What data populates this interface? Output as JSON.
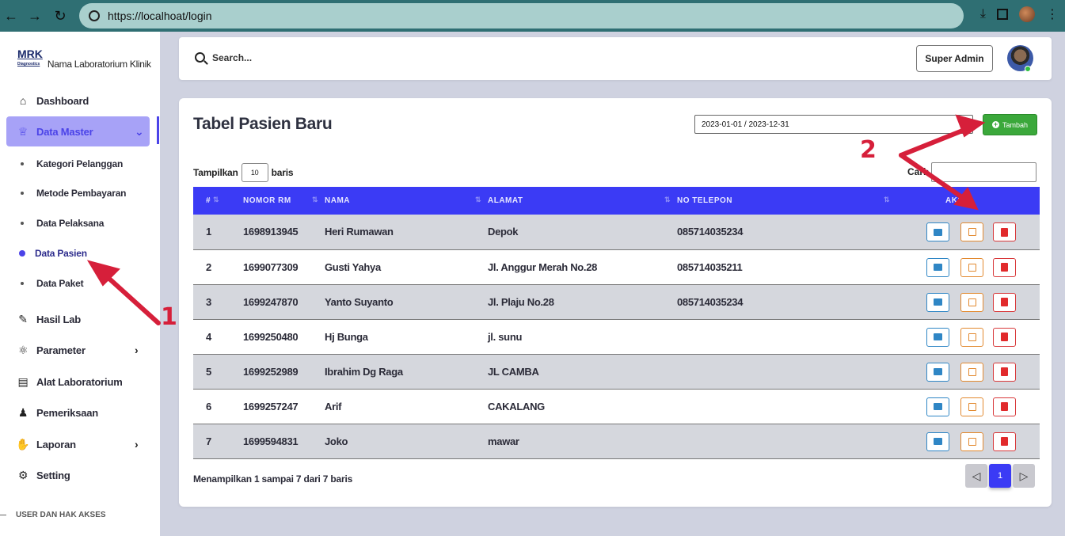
{
  "browser": {
    "url": "https://localhoat/login"
  },
  "brand": {
    "logo": "MRK",
    "logo_sub": "Diagnostics",
    "name": "Nama Laboratorium Klinik"
  },
  "sidebar": {
    "items": [
      {
        "label": "Dashboard",
        "icon": "home-icon"
      },
      {
        "label": "Data Master",
        "icon": "crown-icon"
      },
      {
        "label": "Hasil Lab",
        "icon": "pen-icon"
      },
      {
        "label": "Parameter",
        "icon": "atom-icon"
      },
      {
        "label": "Alat Laboratorium",
        "icon": "briefcase-icon"
      },
      {
        "label": "Pemeriksaan",
        "icon": "user-check-icon"
      },
      {
        "label": "Laporan",
        "icon": "hand-money-icon"
      },
      {
        "label": "Setting",
        "icon": "gear-icon"
      }
    ],
    "sub_items": [
      {
        "label": "Kategori Pelanggan"
      },
      {
        "label": "Metode Pembayaran"
      },
      {
        "label": "Data Pelaksana"
      },
      {
        "label": "Data Pasien"
      },
      {
        "label": "Data Paket"
      }
    ],
    "section_header": "USER DAN HAK AKSES"
  },
  "topbar": {
    "search_placeholder": "Search...",
    "role": "Super Admin"
  },
  "main": {
    "title": "Tabel Pasien Baru",
    "date_range": "2023-01-01 / 2023-12-31",
    "add_label": "Tambah",
    "length_prefix": "Tampilkan",
    "length_value": "10",
    "length_suffix": "baris",
    "search_label": "Cari:",
    "columns": [
      "#",
      "NOMOR RM",
      "NAMA",
      "ALAMAT",
      "NO TELEPON",
      "AKSI"
    ],
    "rows": [
      {
        "no": "1",
        "rm": "1698913945",
        "nama": "Heri Rumawan",
        "alamat": "Depok",
        "telepon": "085714035234"
      },
      {
        "no": "2",
        "rm": "1699077309",
        "nama": "Gusti Yahya",
        "alamat": "Jl. Anggur Merah No.28",
        "telepon": "085714035211"
      },
      {
        "no": "3",
        "rm": "1699247870",
        "nama": "Yanto Suyanto",
        "alamat": "Jl. Plaju No.28",
        "telepon": "085714035234"
      },
      {
        "no": "4",
        "rm": "1699250480",
        "nama": "Hj Bunga",
        "alamat": "jl. sunu",
        "telepon": ""
      },
      {
        "no": "5",
        "rm": "1699252989",
        "nama": "Ibrahim Dg Raga",
        "alamat": "JL CAMBA",
        "telepon": ""
      },
      {
        "no": "6",
        "rm": "1699257247",
        "nama": "Arif",
        "alamat": "CAKALANG",
        "telepon": ""
      },
      {
        "no": "7",
        "rm": "1699594831",
        "nama": "Joko",
        "alamat": "mawar",
        "telepon": ""
      }
    ],
    "info": "Menampilkan 1 sampai 7 dari 7 baris",
    "current_page": "1"
  },
  "annotations": {
    "marker_1": "1",
    "marker_2": "2"
  },
  "colors": {
    "accent": "#3b3bf5",
    "sidebar_active": "#a7a2f7",
    "add_button": "#3ba83b",
    "annotation": "#d61f3a"
  }
}
